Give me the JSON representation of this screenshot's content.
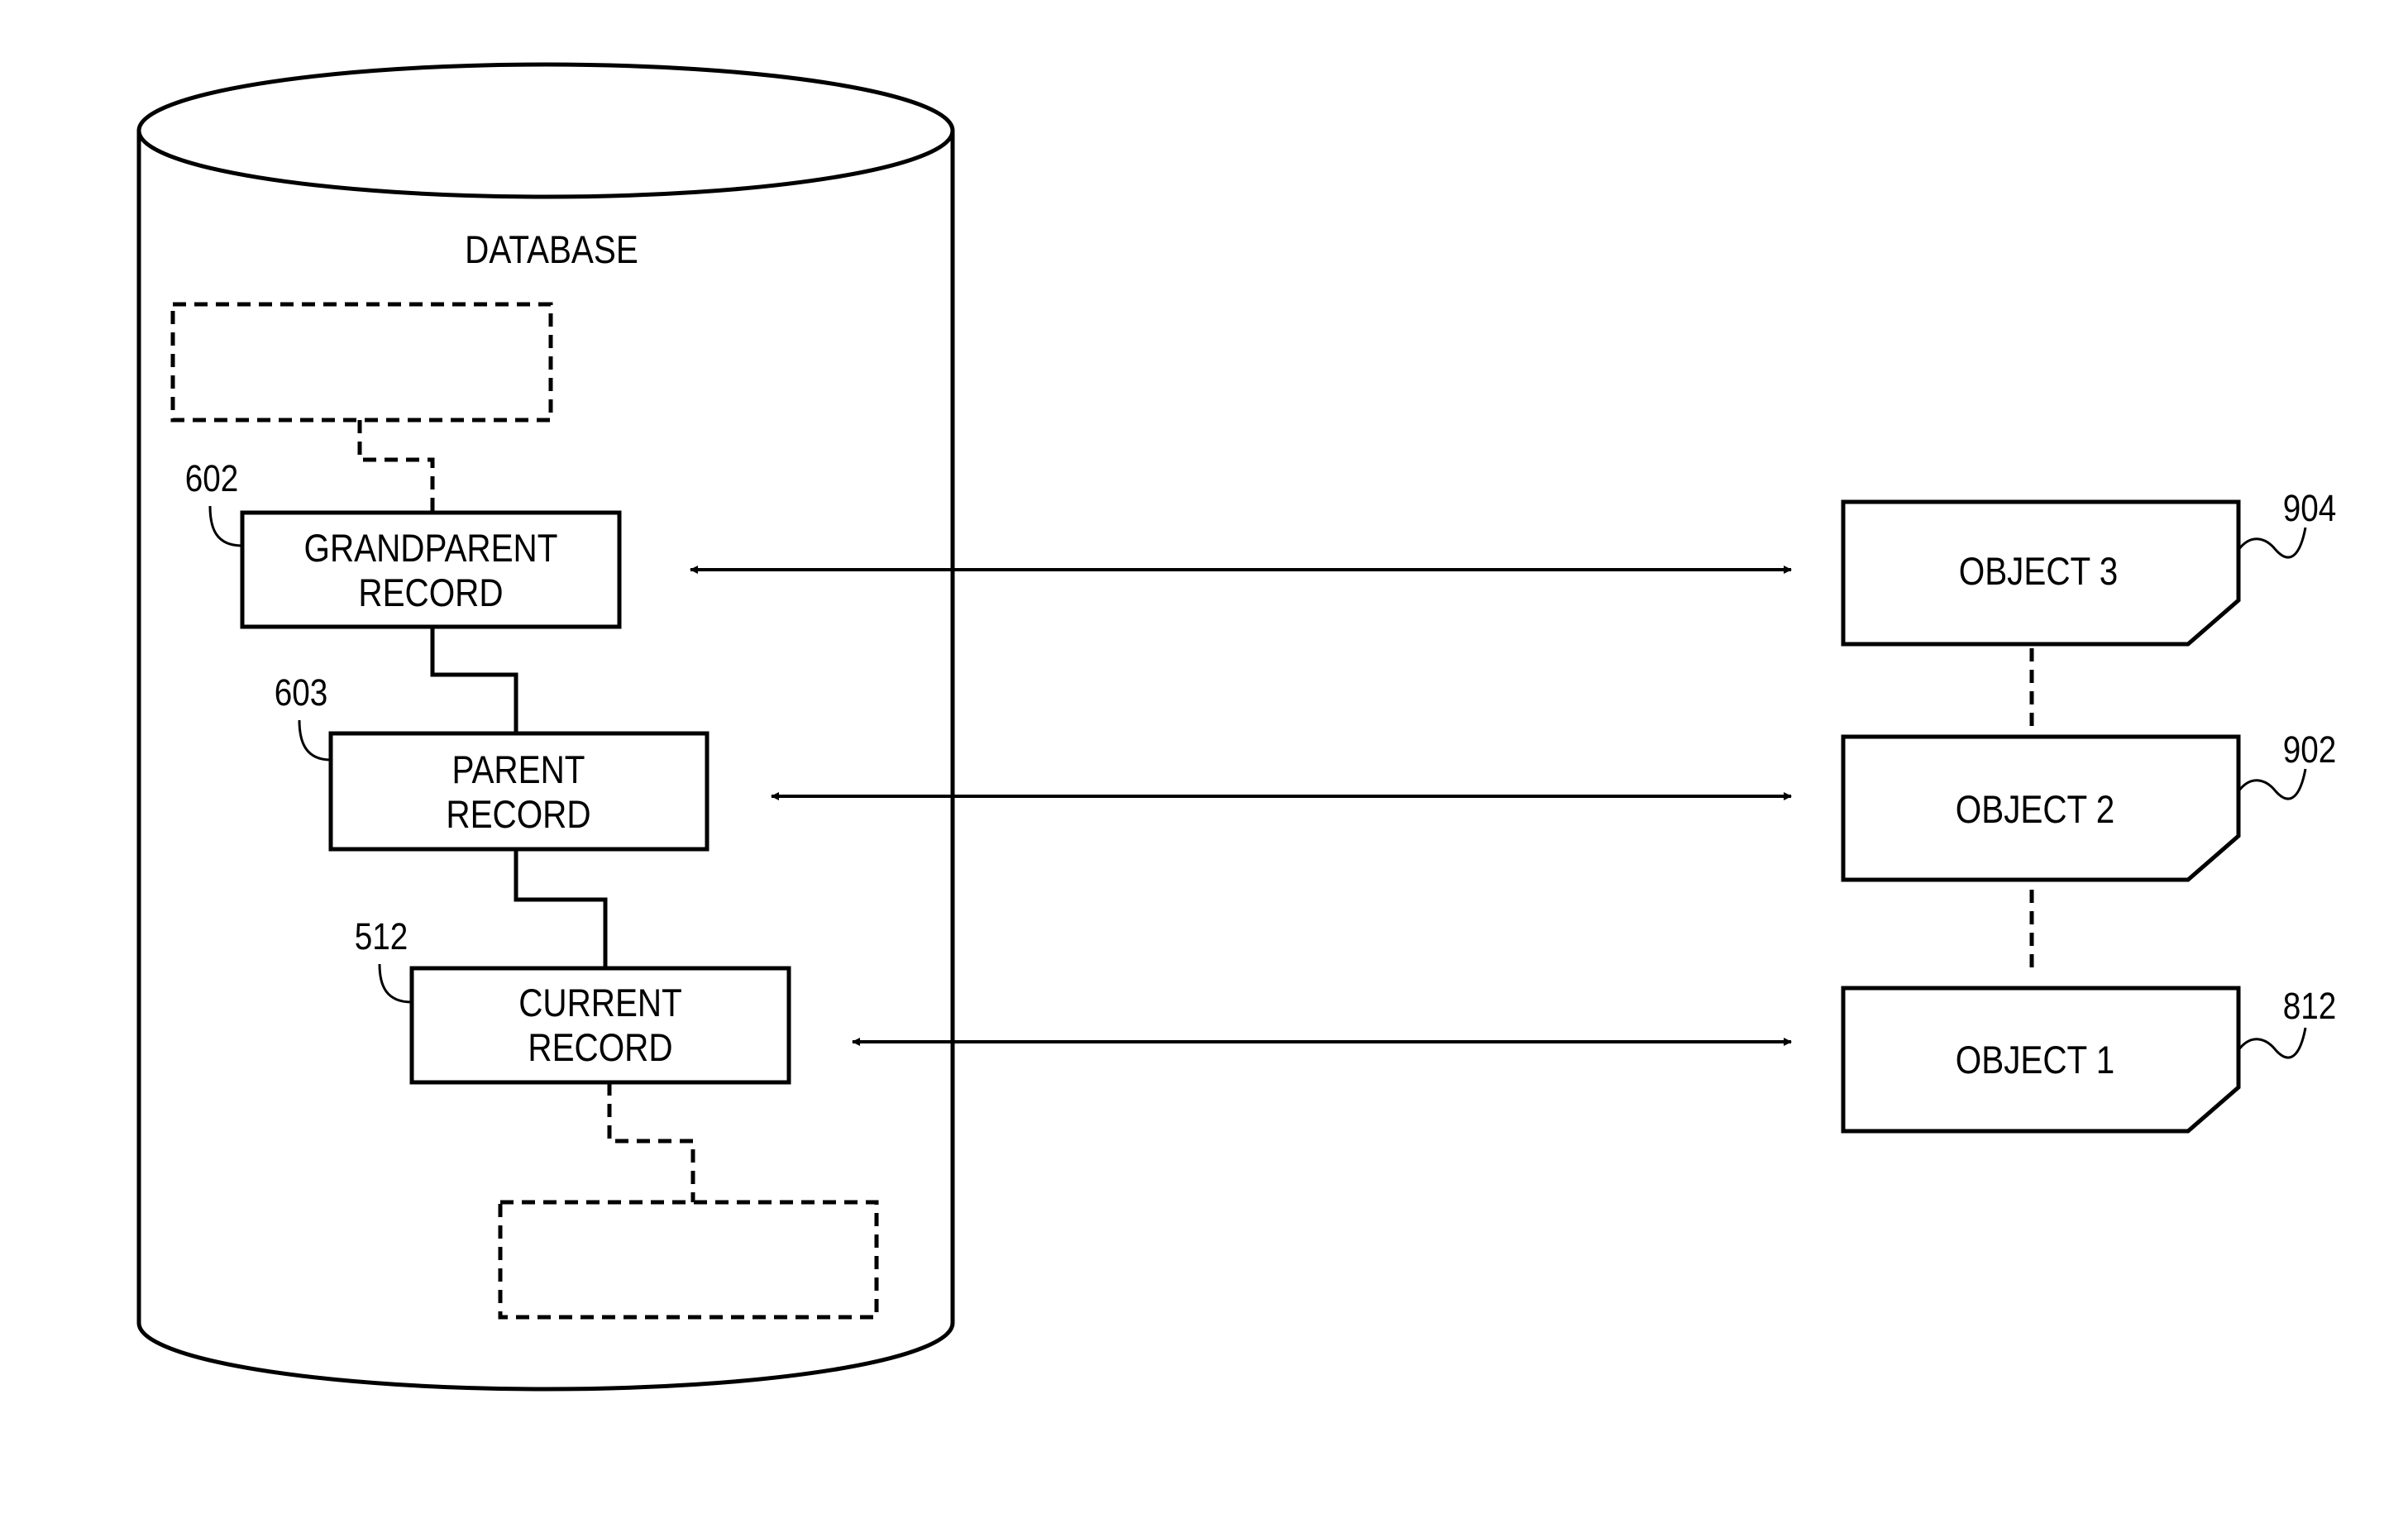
{
  "database": {
    "title": "DATABASE",
    "records": [
      {
        "id": "grandparent",
        "ref": "602",
        "lines": [
          "GRANDPARENT",
          "RECORD"
        ]
      },
      {
        "id": "parent",
        "ref": "603",
        "lines": [
          "PARENT",
          "RECORD"
        ]
      },
      {
        "id": "current",
        "ref": "512",
        "lines": [
          "CURRENT",
          "RECORD"
        ]
      }
    ],
    "placeholder_records": [
      "ancestor-placeholder",
      "descendant-placeholder"
    ]
  },
  "objects": [
    {
      "id": "object-3",
      "label": "OBJECT 3",
      "ref": "904",
      "linked_record": "grandparent"
    },
    {
      "id": "object-2",
      "label": "OBJECT 2",
      "ref": "902",
      "linked_record": "parent"
    },
    {
      "id": "object-1",
      "label": "OBJECT 1",
      "ref": "812",
      "linked_record": "current"
    }
  ],
  "links": [
    {
      "from": "grandparent",
      "to": "object-3",
      "type": "bidirectional"
    },
    {
      "from": "parent",
      "to": "object-2",
      "type": "bidirectional"
    },
    {
      "from": "current",
      "to": "object-1",
      "type": "bidirectional"
    }
  ]
}
